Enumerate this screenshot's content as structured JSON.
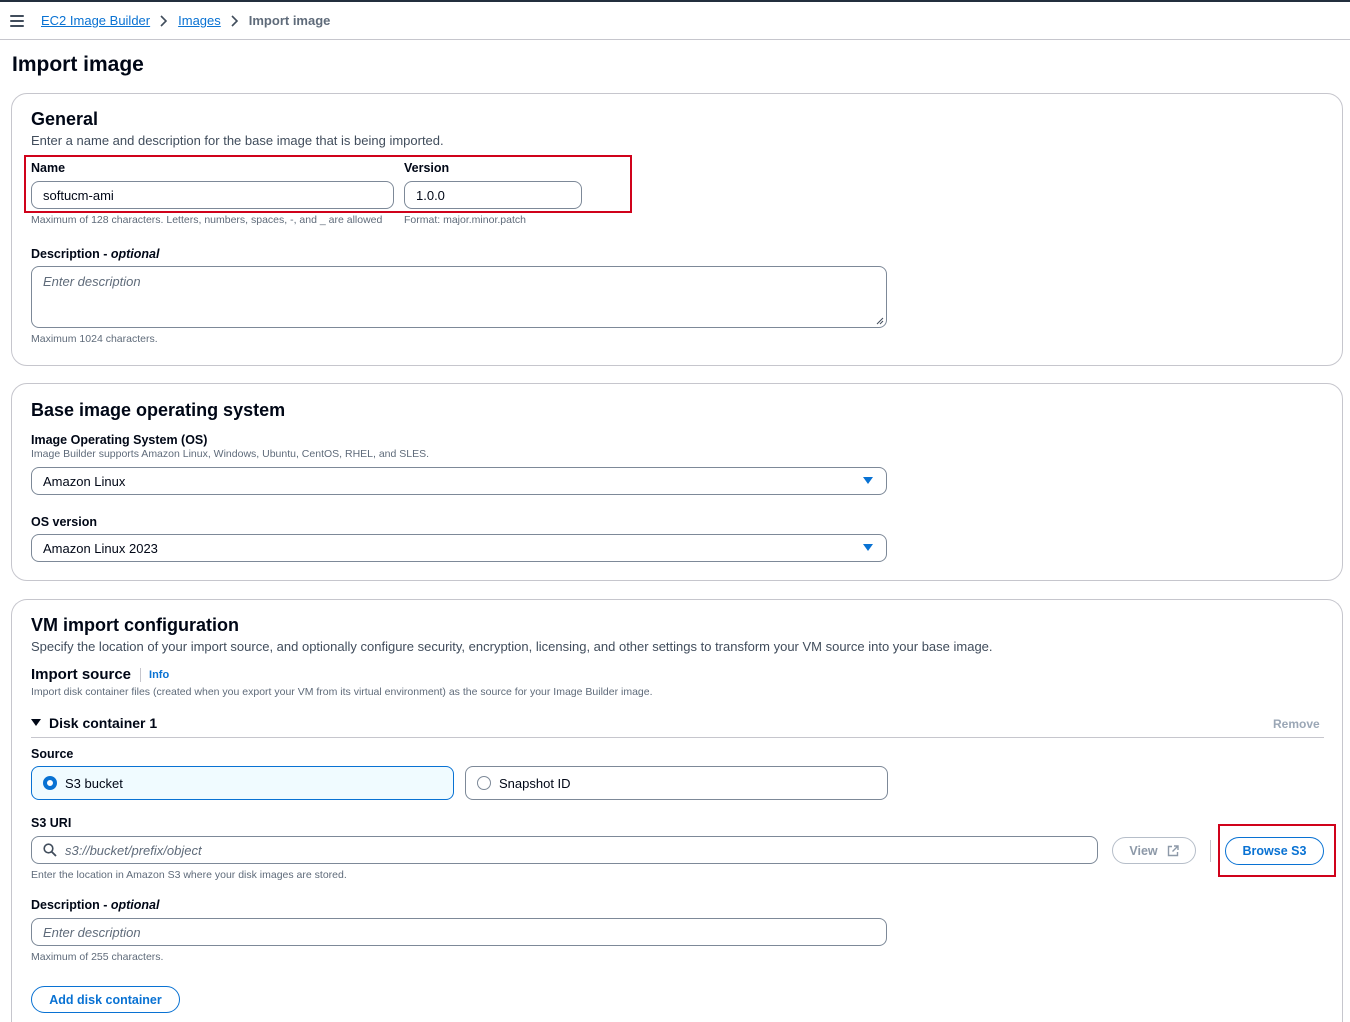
{
  "breadcrumb": {
    "items": [
      "EC2 Image Builder",
      "Images"
    ],
    "current": "Import image"
  },
  "page": {
    "title": "Import image"
  },
  "general": {
    "title": "General",
    "description": "Enter a name and description for the base image that is being imported.",
    "name_label": "Name",
    "name_value": "softucm-ami",
    "name_hint": "Maximum of 128 characters. Letters, numbers, spaces, -, and _ are allowed",
    "version_label": "Version",
    "version_value": "1.0.0",
    "version_hint": "Format: major.minor.patch",
    "description_label": "Description - ",
    "description_optional": "optional",
    "description_placeholder": "Enter description",
    "description_hint": "Maximum 1024 characters."
  },
  "os": {
    "title": "Base image operating system",
    "os_label": "Image Operating System (OS)",
    "os_hint": "Image Builder supports Amazon Linux, Windows, Ubuntu, CentOS, RHEL, and SLES.",
    "os_value": "Amazon Linux",
    "version_label": "OS version",
    "version_value": "Amazon Linux 2023"
  },
  "vm": {
    "title": "VM import configuration",
    "description": "Specify the location of your import source, and optionally configure security, encryption, licensing, and other settings to transform your VM source into your base image.",
    "import_source_title": "Import source",
    "info_label": "Info",
    "import_source_desc": "Import disk container files (created when you export your VM from its virtual environment) as the source for your Image Builder image.",
    "disk_container_title": "Disk container 1",
    "remove_label": "Remove",
    "source_label": "Source",
    "source_options": [
      "S3 bucket",
      "Snapshot ID"
    ],
    "source_selected": "S3 bucket",
    "s3_uri_label": "S3 URI",
    "s3_uri_placeholder": "s3://bucket/prefix/object",
    "view_label": "View",
    "browse_label": "Browse S3",
    "s3_hint": "Enter the location in Amazon S3 where your disk images are stored.",
    "disk_desc_label": "Description - ",
    "disk_desc_optional": "optional",
    "disk_desc_placeholder": "Enter description",
    "disk_desc_hint": "Maximum of 255 characters.",
    "add_disk_label": "Add disk container"
  },
  "colors": {
    "accent": "#0972d3",
    "highlight": "#d0021b",
    "text": "#000716",
    "muted": "#5f6b7a"
  },
  "icons": [
    "menu-icon",
    "chevron-right-icon",
    "caret-down-icon",
    "search-icon",
    "external-link-icon"
  ]
}
